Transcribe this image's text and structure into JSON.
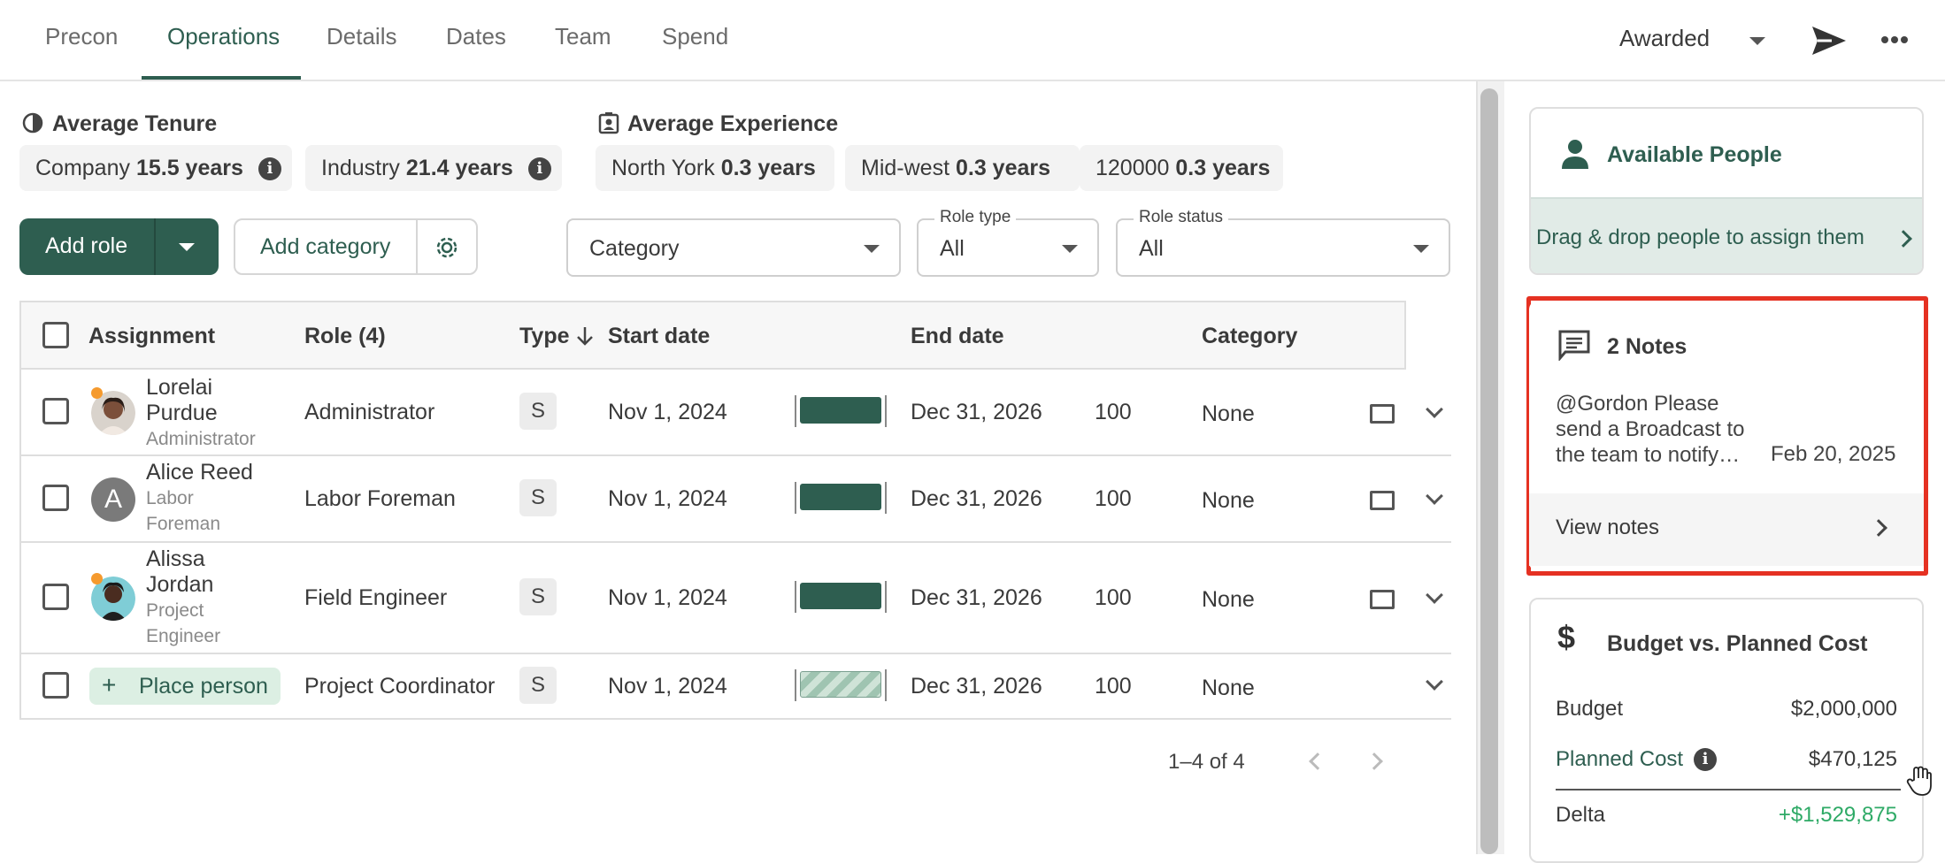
{
  "tabs": [
    {
      "label": "Precon",
      "active": false
    },
    {
      "label": "Operations",
      "active": true
    },
    {
      "label": "Details",
      "active": false
    },
    {
      "label": "Dates",
      "active": false
    },
    {
      "label": "Team",
      "active": false
    },
    {
      "label": "Spend",
      "active": false
    }
  ],
  "header": {
    "status": "Awarded"
  },
  "tenure": {
    "title": "Average Tenure",
    "company_label": "Company",
    "company_value": "15.5 years",
    "industry_label": "Industry",
    "industry_value": "21.4 years"
  },
  "experience": {
    "title": "Average Experience",
    "items": [
      {
        "label": "North York",
        "value": "0.3 years"
      },
      {
        "label": "Mid-west",
        "value": "0.3 years"
      },
      {
        "label": "120000",
        "value": "0.3 years"
      }
    ]
  },
  "toolbar": {
    "add_role": "Add role",
    "add_category": "Add category",
    "category_select": "Category",
    "role_type_label": "Role type",
    "role_type_value": "All",
    "role_status_label": "Role status",
    "role_status_value": "All"
  },
  "table": {
    "headers": {
      "assignment": "Assignment",
      "role": "Role (4)",
      "type": "Type",
      "start": "Start date",
      "end": "End date",
      "category": "Category"
    },
    "rows": [
      {
        "name1": "Lorelai",
        "name2": "Purdue",
        "sub1": "Administrator",
        "sub2": "",
        "role": "Administrator",
        "type": "S",
        "start": "Nov 1, 2024",
        "end": "Dec 31, 2026",
        "alloc": "100",
        "category": "None"
      },
      {
        "name1": "Alice Reed",
        "name2": "",
        "sub1": "Labor",
        "sub2": "Foreman",
        "avatar_letter": "A",
        "role": "Labor Foreman",
        "type": "S",
        "start": "Nov 1, 2024",
        "end": "Dec 31, 2026",
        "alloc": "100",
        "category": "None"
      },
      {
        "name1": "Alissa",
        "name2": "Jordan",
        "sub1": "Project",
        "sub2": "Engineer",
        "role": "Field Engineer",
        "type": "S",
        "start": "Nov 1, 2024",
        "end": "Dec 31, 2026",
        "alloc": "100",
        "category": "None"
      },
      {
        "place_person": "Place person",
        "role": "Project Coordinator",
        "type": "S",
        "start": "Nov 1, 2024",
        "end": "Dec 31, 2026",
        "alloc": "100",
        "category": "None"
      }
    ],
    "pagination": "1–4 of 4"
  },
  "available": {
    "title": "Available People",
    "hint": "Drag & drop people to assign them"
  },
  "notes": {
    "title": "2 Notes",
    "line1": "@Gordon Please",
    "line2": "send a Broadcast to",
    "line3": "the team to notify…",
    "date": "Feb 20, 2025",
    "view": "View notes"
  },
  "budget": {
    "title": "Budget vs. Planned Cost",
    "budget_label": "Budget",
    "budget_value": "$2,000,000",
    "planned_label": "Planned Cost",
    "planned_value": "$470,125",
    "delta_label": "Delta",
    "delta_value": "+$1,529,875"
  },
  "colors": {
    "brand": "#2e5e50",
    "highlight": "#e53122",
    "positive": "#2eaa66"
  }
}
